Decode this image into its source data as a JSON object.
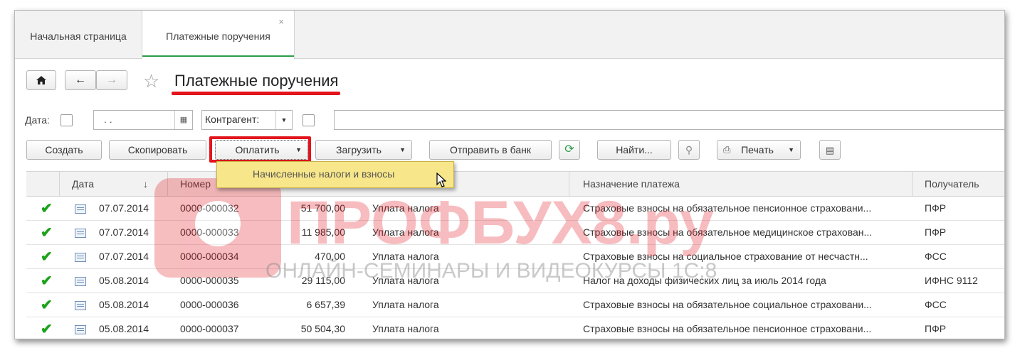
{
  "tabs": [
    {
      "label": "Начальная страница"
    },
    {
      "label": "Платежные поручения",
      "close": "×"
    }
  ],
  "page": {
    "title": "Платежные поручения"
  },
  "filters": {
    "date_label": "Дата:",
    "date_value": " .  .",
    "counterparty_label": "Контрагент:"
  },
  "toolbar": {
    "create": "Создать",
    "copy": "Скопировать",
    "pay": "Оплатить",
    "load": "Загрузить",
    "send_bank": "Отправить в банк",
    "find": "Найти...",
    "print": "Печать"
  },
  "pay_menu": {
    "items": [
      "Начисленные налоги и взносы"
    ]
  },
  "grid": {
    "columns": {
      "date": "Дата",
      "number": "Номер",
      "purpose": "Назначение платежа",
      "recipient": "Получатель",
      "sort": "↓"
    },
    "rows": [
      {
        "date": "07.07.2014",
        "number": "0000-000032",
        "amount": "51 700,00",
        "kind": "Уплата налога",
        "purpose": "Страховые взносы на обязательное пенсионное страховани...",
        "recipient": "ПФР"
      },
      {
        "date": "07.07.2014",
        "number": "0000-000033",
        "amount": "11 985,00",
        "kind": "Уплата налога",
        "purpose": "Страховые взносы на обязательное медицинское страхован...",
        "recipient": "ПФР"
      },
      {
        "date": "07.07.2014",
        "number": "0000-000034",
        "amount": "470,00",
        "kind": "Уплата налога",
        "purpose": "Страховые взносы на социальное страхование от несчастн...",
        "recipient": "ФСС"
      },
      {
        "date": "05.08.2014",
        "number": "0000-000035",
        "amount": "29 115,00",
        "kind": "Уплата налога",
        "purpose": "Налог на доходы физических лиц за июль 2014 года",
        "recipient": "ИФНС 9112"
      },
      {
        "date": "05.08.2014",
        "number": "0000-000036",
        "amount": "6 657,39",
        "kind": "Уплата налога",
        "purpose": "Страховые взносы на обязательное социальное страховани...",
        "recipient": "ФСС"
      },
      {
        "date": "05.08.2014",
        "number": "0000-000037",
        "amount": "50 504,30",
        "kind": "Уплата налога",
        "purpose": "Страховые взносы на обязательное пенсионное страховани...",
        "recipient": "ПФР"
      }
    ]
  },
  "watermark": {
    "brand": "ПРОФБУХ8.ру",
    "tagline": "ОНЛАЙН-СЕМИНАРЫ И ВИДЕОКУРСЫ 1С:8"
  },
  "colors": {
    "accent_red": "#e3141c",
    "check_green": "#1aa31a",
    "tab_underline": "#2a9c47",
    "menu_yellow": "#f7e68a"
  }
}
